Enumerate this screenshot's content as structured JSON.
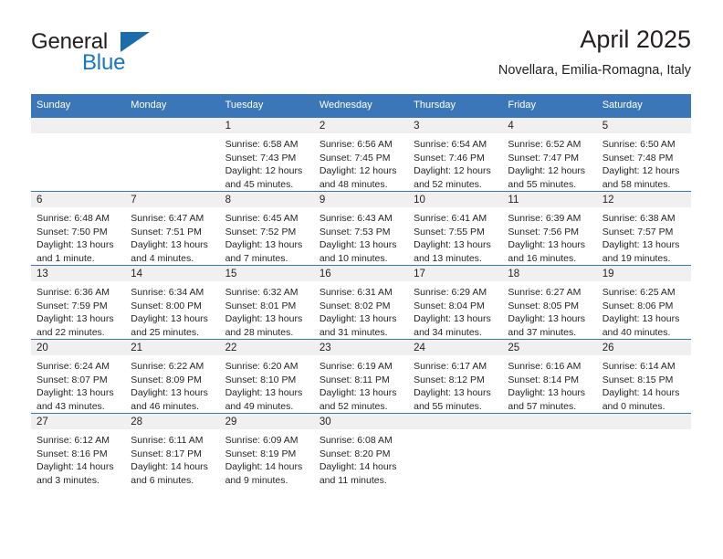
{
  "brand": {
    "word1": "General",
    "word2": "Blue",
    "triangle_color": "#1b6cab",
    "blue_text_color": "#1777c4"
  },
  "header": {
    "title": "April 2025",
    "subtitle": "Novellara, Emilia-Romagna, Italy"
  },
  "theme": {
    "header_blue": "#3b77b8",
    "daynum_band": "#f0f0f0",
    "text": "#231f20"
  },
  "calendar": {
    "weekday_headers": [
      "Sunday",
      "Monday",
      "Tuesday",
      "Wednesday",
      "Thursday",
      "Friday",
      "Saturday"
    ],
    "weeks": [
      [
        {
          "day": "",
          "lines": []
        },
        {
          "day": "",
          "lines": []
        },
        {
          "day": "1",
          "lines": [
            "Sunrise: 6:58 AM",
            "Sunset: 7:43 PM",
            "Daylight: 12 hours",
            "and 45 minutes."
          ]
        },
        {
          "day": "2",
          "lines": [
            "Sunrise: 6:56 AM",
            "Sunset: 7:45 PM",
            "Daylight: 12 hours",
            "and 48 minutes."
          ]
        },
        {
          "day": "3",
          "lines": [
            "Sunrise: 6:54 AM",
            "Sunset: 7:46 PM",
            "Daylight: 12 hours",
            "and 52 minutes."
          ]
        },
        {
          "day": "4",
          "lines": [
            "Sunrise: 6:52 AM",
            "Sunset: 7:47 PM",
            "Daylight: 12 hours",
            "and 55 minutes."
          ]
        },
        {
          "day": "5",
          "lines": [
            "Sunrise: 6:50 AM",
            "Sunset: 7:48 PM",
            "Daylight: 12 hours",
            "and 58 minutes."
          ]
        }
      ],
      [
        {
          "day": "6",
          "lines": [
            "Sunrise: 6:48 AM",
            "Sunset: 7:50 PM",
            "Daylight: 13 hours",
            "and 1 minute."
          ]
        },
        {
          "day": "7",
          "lines": [
            "Sunrise: 6:47 AM",
            "Sunset: 7:51 PM",
            "Daylight: 13 hours",
            "and 4 minutes."
          ]
        },
        {
          "day": "8",
          "lines": [
            "Sunrise: 6:45 AM",
            "Sunset: 7:52 PM",
            "Daylight: 13 hours",
            "and 7 minutes."
          ]
        },
        {
          "day": "9",
          "lines": [
            "Sunrise: 6:43 AM",
            "Sunset: 7:53 PM",
            "Daylight: 13 hours",
            "and 10 minutes."
          ]
        },
        {
          "day": "10",
          "lines": [
            "Sunrise: 6:41 AM",
            "Sunset: 7:55 PM",
            "Daylight: 13 hours",
            "and 13 minutes."
          ]
        },
        {
          "day": "11",
          "lines": [
            "Sunrise: 6:39 AM",
            "Sunset: 7:56 PM",
            "Daylight: 13 hours",
            "and 16 minutes."
          ]
        },
        {
          "day": "12",
          "lines": [
            "Sunrise: 6:38 AM",
            "Sunset: 7:57 PM",
            "Daylight: 13 hours",
            "and 19 minutes."
          ]
        }
      ],
      [
        {
          "day": "13",
          "lines": [
            "Sunrise: 6:36 AM",
            "Sunset: 7:59 PM",
            "Daylight: 13 hours",
            "and 22 minutes."
          ]
        },
        {
          "day": "14",
          "lines": [
            "Sunrise: 6:34 AM",
            "Sunset: 8:00 PM",
            "Daylight: 13 hours",
            "and 25 minutes."
          ]
        },
        {
          "day": "15",
          "lines": [
            "Sunrise: 6:32 AM",
            "Sunset: 8:01 PM",
            "Daylight: 13 hours",
            "and 28 minutes."
          ]
        },
        {
          "day": "16",
          "lines": [
            "Sunrise: 6:31 AM",
            "Sunset: 8:02 PM",
            "Daylight: 13 hours",
            "and 31 minutes."
          ]
        },
        {
          "day": "17",
          "lines": [
            "Sunrise: 6:29 AM",
            "Sunset: 8:04 PM",
            "Daylight: 13 hours",
            "and 34 minutes."
          ]
        },
        {
          "day": "18",
          "lines": [
            "Sunrise: 6:27 AM",
            "Sunset: 8:05 PM",
            "Daylight: 13 hours",
            "and 37 minutes."
          ]
        },
        {
          "day": "19",
          "lines": [
            "Sunrise: 6:25 AM",
            "Sunset: 8:06 PM",
            "Daylight: 13 hours",
            "and 40 minutes."
          ]
        }
      ],
      [
        {
          "day": "20",
          "lines": [
            "Sunrise: 6:24 AM",
            "Sunset: 8:07 PM",
            "Daylight: 13 hours",
            "and 43 minutes."
          ]
        },
        {
          "day": "21",
          "lines": [
            "Sunrise: 6:22 AM",
            "Sunset: 8:09 PM",
            "Daylight: 13 hours",
            "and 46 minutes."
          ]
        },
        {
          "day": "22",
          "lines": [
            "Sunrise: 6:20 AM",
            "Sunset: 8:10 PM",
            "Daylight: 13 hours",
            "and 49 minutes."
          ]
        },
        {
          "day": "23",
          "lines": [
            "Sunrise: 6:19 AM",
            "Sunset: 8:11 PM",
            "Daylight: 13 hours",
            "and 52 minutes."
          ]
        },
        {
          "day": "24",
          "lines": [
            "Sunrise: 6:17 AM",
            "Sunset: 8:12 PM",
            "Daylight: 13 hours",
            "and 55 minutes."
          ]
        },
        {
          "day": "25",
          "lines": [
            "Sunrise: 6:16 AM",
            "Sunset: 8:14 PM",
            "Daylight: 13 hours",
            "and 57 minutes."
          ]
        },
        {
          "day": "26",
          "lines": [
            "Sunrise: 6:14 AM",
            "Sunset: 8:15 PM",
            "Daylight: 14 hours",
            "and 0 minutes."
          ]
        }
      ],
      [
        {
          "day": "27",
          "lines": [
            "Sunrise: 6:12 AM",
            "Sunset: 8:16 PM",
            "Daylight: 14 hours",
            "and 3 minutes."
          ]
        },
        {
          "day": "28",
          "lines": [
            "Sunrise: 6:11 AM",
            "Sunset: 8:17 PM",
            "Daylight: 14 hours",
            "and 6 minutes."
          ]
        },
        {
          "day": "29",
          "lines": [
            "Sunrise: 6:09 AM",
            "Sunset: 8:19 PM",
            "Daylight: 14 hours",
            "and 9 minutes."
          ]
        },
        {
          "day": "30",
          "lines": [
            "Sunrise: 6:08 AM",
            "Sunset: 8:20 PM",
            "Daylight: 14 hours",
            "and 11 minutes."
          ]
        },
        {
          "day": "",
          "lines": []
        },
        {
          "day": "",
          "lines": []
        },
        {
          "day": "",
          "lines": []
        }
      ]
    ]
  }
}
